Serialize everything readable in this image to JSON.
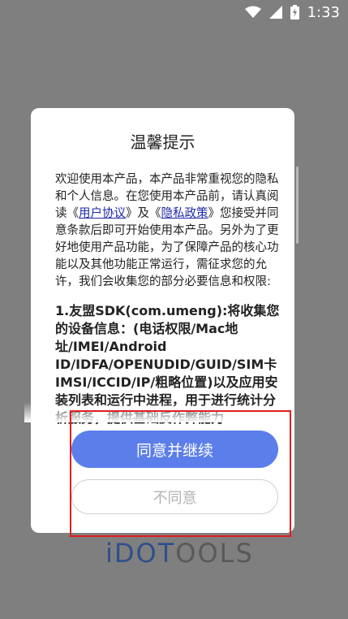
{
  "status_bar": {
    "time": "1:33",
    "icons": [
      "wifi-icon",
      "signal-icon",
      "battery-charging-icon"
    ]
  },
  "dialog": {
    "title": "温馨提示",
    "intro_a": "欢迎使用本产品，本产品非常重视您的隐私和个人信息。在您使用本产品前，请认真阅读《",
    "user_agreement": "用户协议",
    "intro_b": "》及《",
    "privacy_policy": "隐私政策",
    "intro_c": "》您接受并同意条款后即可开始使用本产品。另外为了更好地使用产品功能，为了保障产品的核心功能以及其他功能正常运行，需征求您的允许，我们会收集您的部分必要信息和权限:",
    "item1": "1.友盟SDK(com.umeng):将收集您的设备信息：(电话权限/Mac地址/IMEI/Android ID/IDFA/OPENUDID/GUID/SIM卡IMSI/ICCID/IP/粗略位置)以及应用安装列表和运行中进程，用于进行统计分析服务，提供基础反作弊能力",
    "agree_label": "同意并继续",
    "disagree_label": "不同意"
  },
  "logo": {
    "part_a": "iDOT",
    "part_b": "OOLS"
  },
  "colors": {
    "primary": "#5b7eea",
    "overlay": "#7f7f7f",
    "highlight": "#e01e1e"
  }
}
